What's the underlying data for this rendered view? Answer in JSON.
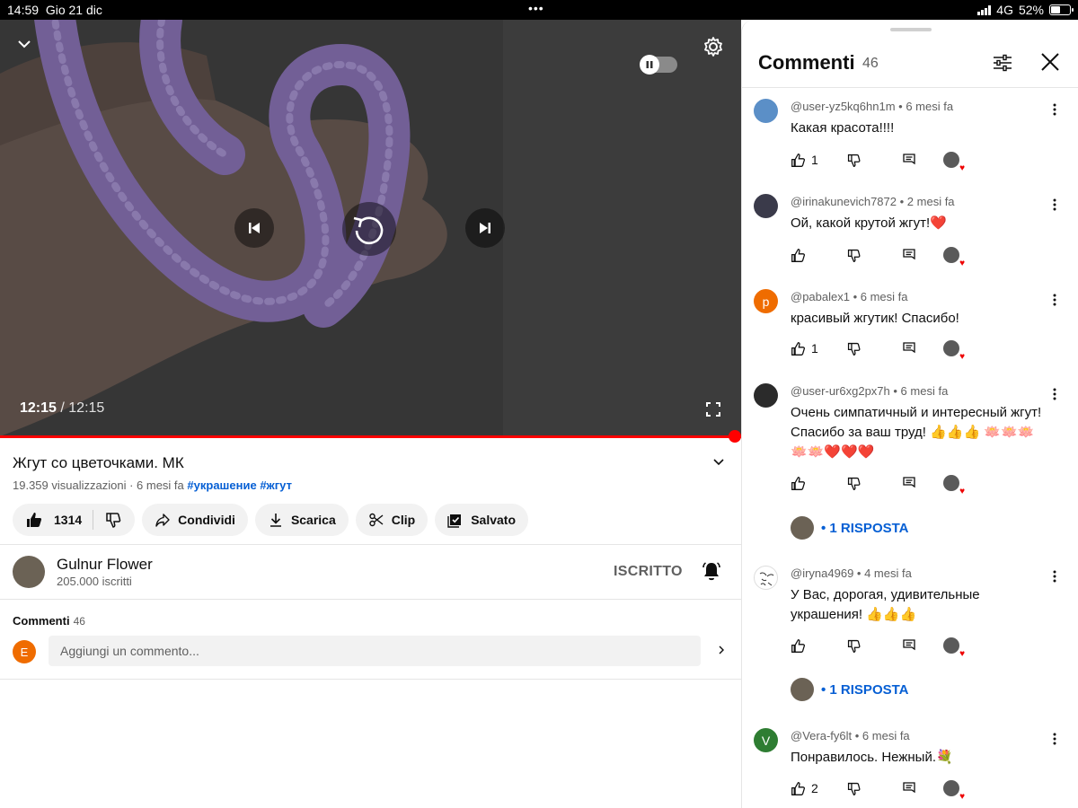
{
  "status_bar": {
    "time": "14:59",
    "date": "Gio 21 dic",
    "network": "4G",
    "battery": "52%",
    "battery_level": 0.52
  },
  "video": {
    "current_time": "12:15",
    "duration": "/ 12:15",
    "progress": 1.0
  },
  "info": {
    "title": "Жгут со цветочками. МК",
    "views": "19.359 visualizzazioni",
    "age": "· 6 mesi fa",
    "tags": [
      "#украшение",
      "#жгут"
    ],
    "likes": "1314",
    "share_label": "Condividi",
    "download_label": "Scarica",
    "clip_label": "Clip",
    "saved_label": "Salvato"
  },
  "channel": {
    "name": "Gulnur Flower",
    "subscribers": "205.000 iscritti",
    "subscribed_label": "ISCRITTO"
  },
  "comments_section": {
    "label": "Commenti",
    "count": "46",
    "my_initial": "E",
    "placeholder": "Aggiungi un commento..."
  },
  "panel": {
    "title": "Commenti",
    "count": "46",
    "reply_label": "• 1 RISPOSTA",
    "comments": [
      {
        "author": "@user-yz5kq6hn1m",
        "time": "• 6 mesi fa",
        "text": "Какая красота!!!!",
        "likes": "1",
        "avatar_color": "#5b8fc7",
        "initial": ""
      },
      {
        "author": "@irinakunevich7872",
        "time": "• 2 mesi fa",
        "text": "Ой, какой крутой жгут!❤️",
        "likes": "",
        "avatar_color": "#3a3a4a",
        "initial": ""
      },
      {
        "author": "@pabalex1",
        "time": "• 6 mesi fa",
        "text": "красивый жгутик! Спасибо!",
        "likes": "1",
        "avatar_color": "#ef6c00",
        "initial": "p"
      },
      {
        "author": "@user-ur6xg2px7h",
        "time": "• 6 mesi fa",
        "text": "Очень симпатичный и интересный жгут! Спасибо за ваш труд! 👍👍👍 🪷🪷🪷🪷🪷❤️❤️❤️",
        "likes": "",
        "avatar_color": "#2b2b2b",
        "initial": ""
      },
      {
        "author": "@iryna4969",
        "time": "• 4 mesi fa",
        "text": "У Вас, дорогая, удивительные украшения! 👍👍👍",
        "likes": "",
        "avatar_color": "#ffffff",
        "initial": ""
      },
      {
        "author": "@Vera-fy6lt",
        "time": "• 6 mesi fa",
        "text": "Понравилось. Нежный.💐",
        "likes": "2",
        "avatar_color": "#2e7d32",
        "initial": "V"
      }
    ]
  }
}
